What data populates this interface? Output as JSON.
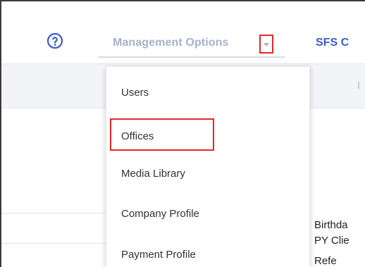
{
  "header": {
    "help_icon": "question-circle-icon",
    "management_label": "Management Options",
    "sfs_label": "SFS C"
  },
  "dropdown": {
    "items": [
      {
        "label": "Users"
      },
      {
        "label": "Offices"
      },
      {
        "label": "Media Library"
      },
      {
        "label": "Company Profile"
      },
      {
        "label": "Payment Profile"
      }
    ],
    "highlighted_index": 1
  },
  "background": {
    "texts": [
      "Birthda",
      "PY Clie",
      "Refe"
    ]
  },
  "colors": {
    "highlight": "#e8262b",
    "menu_inactive": "#a7b1cf",
    "link_blue": "#3a5cc9"
  }
}
